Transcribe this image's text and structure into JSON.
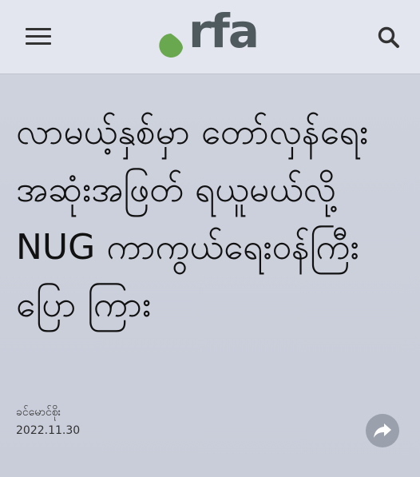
{
  "header": {
    "brand": "rfa",
    "brand_color": "#4f5a5e",
    "accent_color": "#6aa84f",
    "menu_icon": "hamburger-menu-icon",
    "search_icon": "search-icon"
  },
  "article": {
    "headline": "လာမယ့်နှစ်မှာ တော်လှန်ရေးအဆုံးအဖြတ် ရယူမယ်လို့ NUG ကာကွယ်ရေးဝန်ကြီး ပြော ကြား",
    "author": "ခင်မောင်စိုး",
    "date": "2022.11.30",
    "share_icon": "share-arrow-icon"
  }
}
